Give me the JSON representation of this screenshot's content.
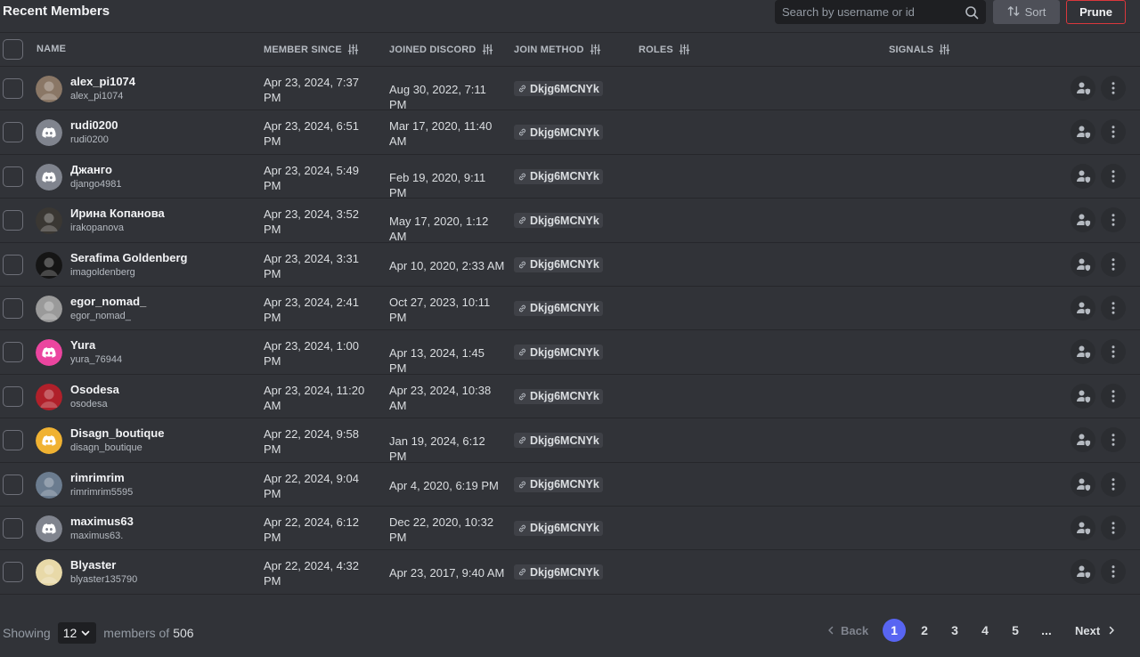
{
  "header": {
    "title": "Recent Members",
    "search_placeholder": "Search by username or id",
    "sort_label": "Sort",
    "prune_label": "Prune"
  },
  "columns": {
    "name": "NAME",
    "member_since": "MEMBER SINCE",
    "joined_discord": "JOINED DISCORD",
    "join_method": "JOIN METHOD",
    "roles": "ROLES",
    "signals": "SIGNALS"
  },
  "members": [
    {
      "display": "alex_pi1074",
      "username": "alex_pi1074",
      "member_since": "Apr 23, 2024, 7:37 PM",
      "joined": "Aug 30, 2022, 7:11 PM",
      "invite": "Dkjg6MCNYk",
      "avatar": "photo",
      "avatar_color": "#8a7766"
    },
    {
      "display": "rudi0200",
      "username": "rudi0200",
      "member_since": "Apr 23, 2024, 6:51 PM",
      "joined": "Mar 17, 2020, 11:40 AM",
      "invite": "Dkjg6MCNYk",
      "avatar": "discord",
      "avatar_color": "#80848e"
    },
    {
      "display": "Джанго",
      "username": "django4981",
      "member_since": "Apr 23, 2024, 5:49 PM",
      "joined": "Feb 19, 2020, 9:11 PM",
      "invite": "Dkjg6MCNYk",
      "avatar": "discord",
      "avatar_color": "#80848e"
    },
    {
      "display": "Ирина Копанова",
      "username": "irakopanova",
      "member_since": "Apr 23, 2024, 3:52 PM",
      "joined": "May 17, 2020, 1:12 AM",
      "invite": "Dkjg6MCNYk",
      "avatar": "photo",
      "avatar_color": "#3a3733"
    },
    {
      "display": "Serafima Goldenberg",
      "username": "imagoldenberg",
      "member_since": "Apr 23, 2024, 3:31 PM",
      "joined": "Apr 10, 2020, 2:33 AM",
      "invite": "Dkjg6MCNYk",
      "avatar": "photo",
      "avatar_color": "#151515"
    },
    {
      "display": "egor_nomad_",
      "username": "egor_nomad_",
      "member_since": "Apr 23, 2024, 2:41 PM",
      "joined": "Oct 27, 2023, 10:11 PM",
      "invite": "Dkjg6MCNYk",
      "avatar": "photo",
      "avatar_color": "#9a9a9a"
    },
    {
      "display": "Yura",
      "username": "yura_76944",
      "member_since": "Apr 23, 2024, 1:00 PM",
      "joined": "Apr 13, 2024, 1:45 PM",
      "invite": "Dkjg6MCNYk",
      "avatar": "discord",
      "avatar_color": "#eb459f"
    },
    {
      "display": "Osodesa",
      "username": "osodesa",
      "member_since": "Apr 23, 2024, 11:20 AM",
      "joined": "Apr 23, 2024, 10:38 AM",
      "invite": "Dkjg6MCNYk",
      "avatar": "photo",
      "avatar_color": "#b0202a"
    },
    {
      "display": "Disagn_boutique",
      "username": "disagn_boutique",
      "member_since": "Apr 22, 2024, 9:58 PM",
      "joined": "Jan 19, 2024, 6:12 PM",
      "invite": "Dkjg6MCNYk",
      "avatar": "discord",
      "avatar_color": "#f0b232"
    },
    {
      "display": "rimrimrim",
      "username": "rimrimrim5595",
      "member_since": "Apr 22, 2024, 9:04 PM",
      "joined": "Apr 4, 2020, 6:19 PM",
      "invite": "Dkjg6MCNYk",
      "avatar": "photo",
      "avatar_color": "#6b7c8f"
    },
    {
      "display": "maximus63",
      "username": "maximus63.",
      "member_since": "Apr 22, 2024, 6:12 PM",
      "joined": "Dec 22, 2020, 10:32 PM",
      "invite": "Dkjg6MCNYk",
      "avatar": "discord",
      "avatar_color": "#80848e"
    },
    {
      "display": "Blyaster",
      "username": "blyaster135790",
      "member_since": "Apr 22, 2024, 4:32 PM",
      "joined": "Apr 23, 2017, 9:40 AM",
      "invite": "Dkjg6MCNYk",
      "avatar": "photo",
      "avatar_color": "#e8d9a8"
    }
  ],
  "footer": {
    "showing_label": "Showing",
    "page_size": "12",
    "members_of_label": "members of",
    "total": "506",
    "back_label": "Back",
    "next_label": "Next",
    "pages": [
      "1",
      "2",
      "3",
      "4",
      "5"
    ],
    "ellipsis": "...",
    "current_page": "1"
  }
}
